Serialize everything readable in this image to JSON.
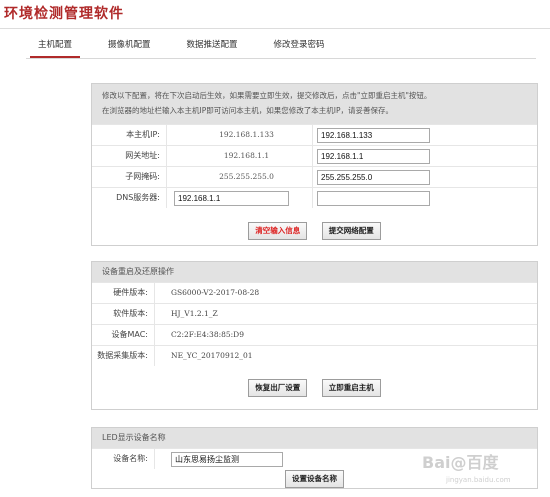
{
  "app": {
    "title": "环境检测管理软件"
  },
  "tabs": [
    {
      "label": "主机配置",
      "active": true
    },
    {
      "label": "摄像机配置",
      "active": false
    },
    {
      "label": "数据推送配置",
      "active": false
    },
    {
      "label": "修改登录密码",
      "active": false
    }
  ],
  "network": {
    "notice_1": "修改以下配置，将在下次启动后生效，如果需要立即生效，提交修改后，点击\"立即重启主机\"按钮。",
    "notice_2": "在浏览器的地址栏输入本主机IP即可访问本主机，如果您修改了本主机IP，请妥善保存。",
    "rows": [
      {
        "label": "本主机IP:",
        "current": "192.168.1.133",
        "input": "192.168.1.133"
      },
      {
        "label": "网关地址:",
        "current": "192.168.1.1",
        "input": "192.168.1.1"
      },
      {
        "label": "子网掩码:",
        "current": "255.255.255.0",
        "input": "255.255.255.0"
      }
    ],
    "dns": {
      "label": "DNS服务器:",
      "input_1": "192.168.1.1",
      "input_2": ""
    },
    "clear_label": "清空输入信息",
    "submit_label": "提交网络配置"
  },
  "device": {
    "title": "设备重启及还原操作",
    "rows": [
      {
        "label": "硬件版本:",
        "value": "GS6000-V2-2017-08-28"
      },
      {
        "label": "软件版本:",
        "value": "HJ_V1.2.1_Z"
      },
      {
        "label": "设备MAC:",
        "value": "C2:2F:E4:38:85:D9"
      },
      {
        "label": "数据采集版本:",
        "value": "NE_YC_20170912_01"
      }
    ],
    "factory_label": "恢复出厂设置",
    "reboot_label": "立即重启主机"
  },
  "led": {
    "title": "LED显示设备名称",
    "label": "设备名称:",
    "input": "山东思易扬尘监测",
    "submit_label": "设置设备名称"
  },
  "watermark": {
    "main": "Bai@百度",
    "sub": "jingyan.baidu.com"
  }
}
